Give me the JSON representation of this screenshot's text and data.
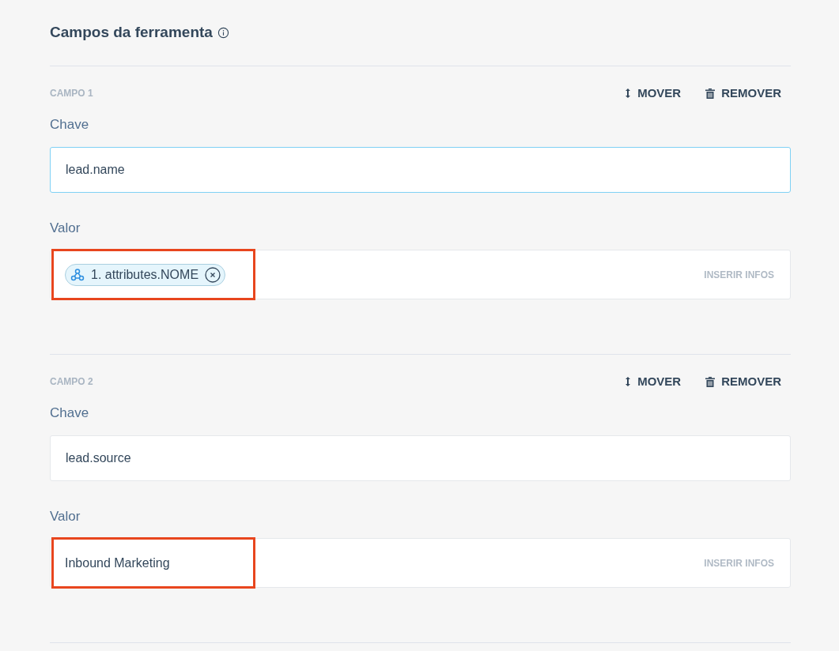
{
  "section": {
    "title": "Campos da ferramenta"
  },
  "fields": [
    {
      "label": "CAMPO 1",
      "move": "MOVER",
      "remove": "REMOVER",
      "key_label": "Chave",
      "key_value": "lead.name",
      "key_focused": true,
      "value_label": "Valor",
      "value": {
        "kind": "chip",
        "text": "1. attributes.NOME",
        "highlighted": true
      },
      "insert": "INSERIR INFOS"
    },
    {
      "label": "CAMPO 2",
      "move": "MOVER",
      "remove": "REMOVER",
      "key_label": "Chave",
      "key_value": "lead.source",
      "key_focused": false,
      "value_label": "Valor",
      "value": {
        "kind": "text",
        "text": "Inbound Marketing",
        "highlighted": true
      },
      "insert": "INSERIR INFOS"
    }
  ]
}
